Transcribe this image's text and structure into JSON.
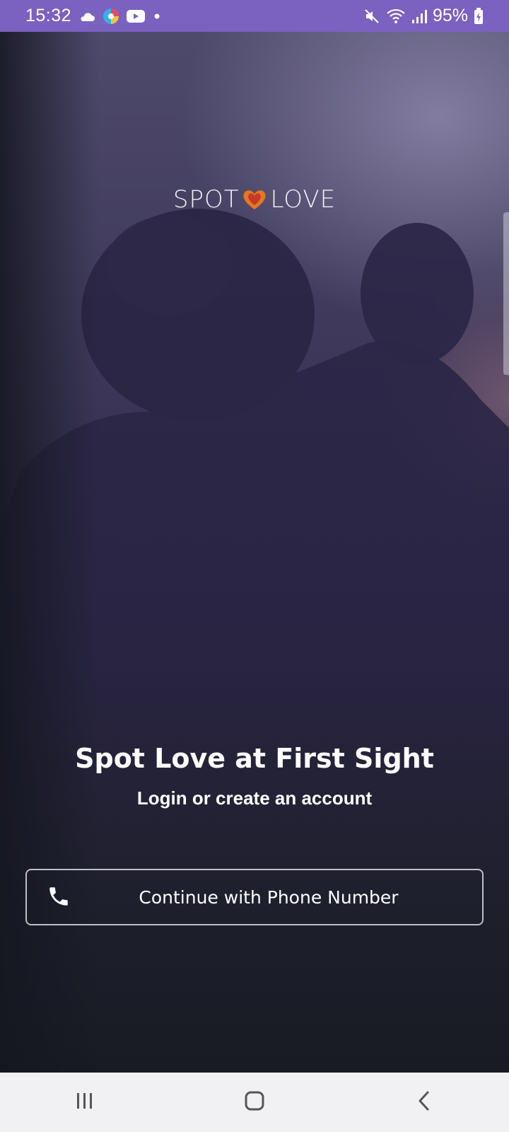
{
  "status_bar": {
    "time": "15:32",
    "battery": "95%",
    "icons": [
      "cloud-icon",
      "edge-browser-icon",
      "youtube-icon",
      "notification-dot-icon",
      "mute-icon",
      "wifi-icon",
      "signal-icon",
      "battery-charging-icon"
    ]
  },
  "logo": {
    "left_text": "SPOT",
    "right_text": "LOVE",
    "heart_icon": "heart-icon",
    "heart_color": "#e8781e"
  },
  "main": {
    "headline": "Spot Love at First Sight",
    "subline": "Login or create an account",
    "phone_button_label": "Continue with Phone Number",
    "phone_icon": "phone-icon"
  },
  "nav_bar": {
    "icons": [
      "recent-apps-icon",
      "home-icon",
      "back-icon"
    ]
  },
  "colors": {
    "status_bar": "#7b61c0",
    "nav_bar": "#f1f1f3",
    "text": "#ffffff"
  }
}
